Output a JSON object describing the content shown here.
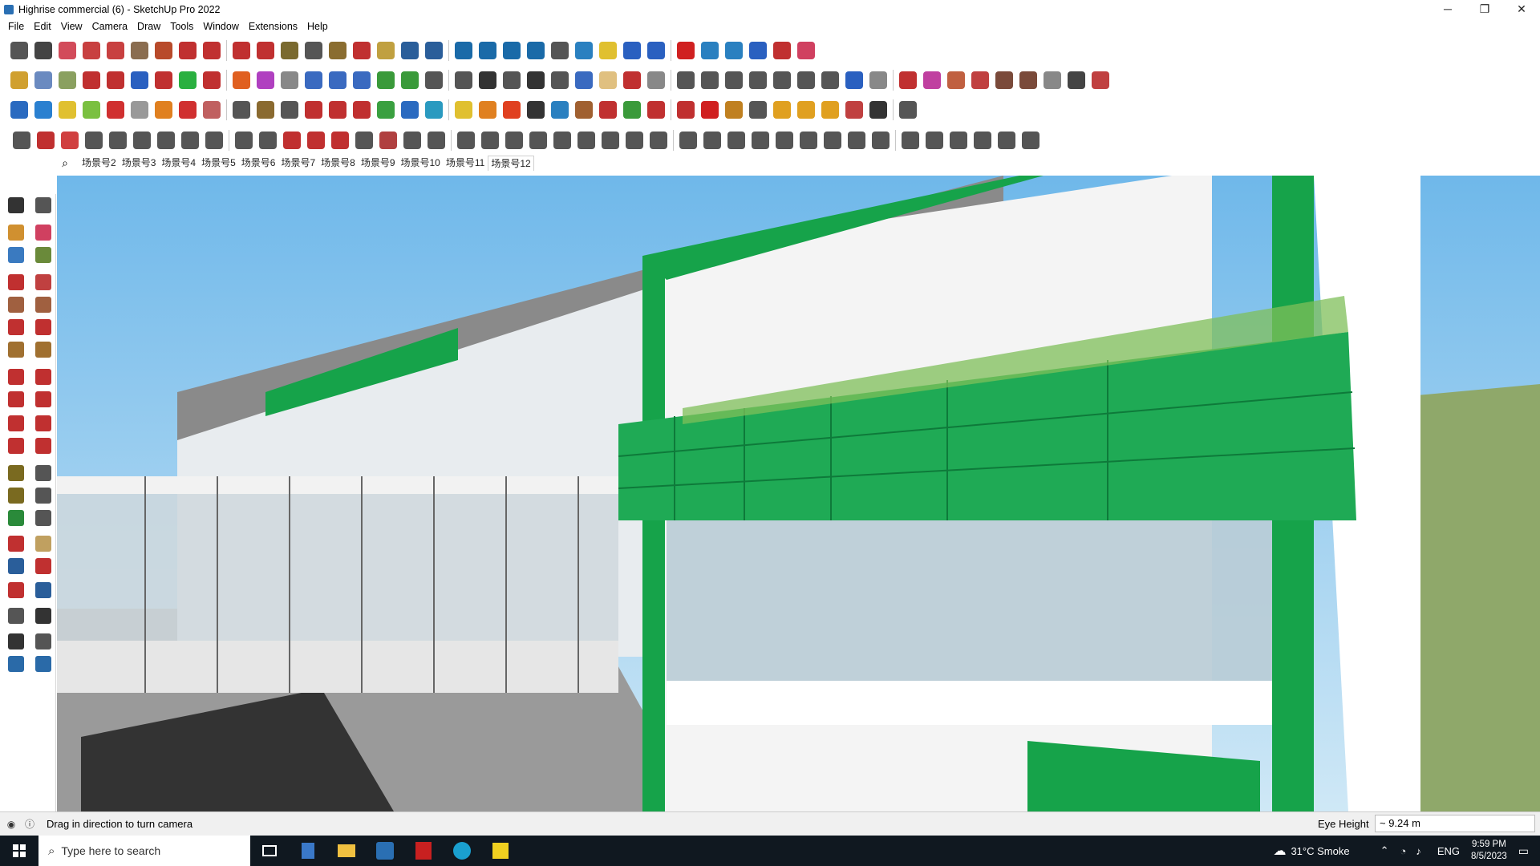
{
  "window": {
    "title": "Highrise commercial (6) - SketchUp Pro 2022",
    "minimize": "─",
    "maximize": "❐",
    "close": "✕"
  },
  "menu": [
    "File",
    "Edit",
    "View",
    "Camera",
    "Draw",
    "Tools",
    "Window",
    "Extensions",
    "Help"
  ],
  "toolbars": {
    "row1": [
      "#555",
      "#444",
      "#d24b5a",
      "#c84040",
      "#c84040",
      "#8a6d50",
      "#b84a2a",
      "#c03030",
      "#c03030",
      "#c03030",
      "#c03030",
      "#7a6a30",
      "#555",
      "#8a6d30",
      "#c03030",
      "#c0a040",
      "#2a5e9a",
      "#2a5e9a",
      "#1a6aa8",
      "#1a6aa8",
      "#1a6aa8",
      "#1a6aa8",
      "#555",
      "#2a80c0",
      "#e0c030",
      "#2a60c0",
      "#2a60c0",
      "#d02020",
      "#2a80c0",
      "#2a80c0",
      "#2a60c0",
      "#c03030",
      "#d04060"
    ],
    "row2": [
      "#d0a030",
      "#6a8ac0",
      "#8aa060",
      "#c03030",
      "#c03030",
      "#2a60c0",
      "#c03030",
      "#2ab040",
      "#c03030",
      "#e06020",
      "#b040c0",
      "#888",
      "#3a6ac0",
      "#3a6ac0",
      "#3a6ac0",
      "#3a9a3a",
      "#3a9a3a",
      "#555",
      "#555",
      "#333",
      "#555",
      "#333",
      "#555",
      "#3a6ac0",
      "#e0c080",
      "#c03030",
      "#888",
      "#555",
      "#555",
      "#555",
      "#555",
      "#555",
      "#555",
      "#555",
      "#2a60c0",
      "#888",
      "#c03030",
      "#c040a0",
      "#c06040",
      "#c04040",
      "#7a4a3a",
      "#7a4a3a",
      "#888",
      "#444",
      "#c04040"
    ],
    "row3": [
      "#2a6ac0",
      "#2a80d0",
      "#e0c030",
      "#7ac040",
      "#d03030",
      "#999",
      "#e08020",
      "#d03030",
      "#c06060",
      "#555",
      "#8a6a30",
      "#555",
      "#c03030",
      "#c03030",
      "#c03030",
      "#3aa040",
      "#2a6ac0",
      "#2a9ac0",
      "#e0c030",
      "#e08020",
      "#e04020",
      "#333",
      "#2a80c0",
      "#a06030",
      "#c03030",
      "#3a9a3a",
      "#c03030",
      "#c03030",
      "#d02020",
      "#c08020",
      "#555",
      "#e0a020",
      "#e0a020",
      "#e0a020",
      "#c04040",
      "#333",
      "#555"
    ],
    "row4": [
      "#555",
      "#c03030",
      "#d04040",
      "#555",
      "#555",
      "#555",
      "#555",
      "#555",
      "#555",
      "#555",
      "#555",
      "#c03030",
      "#c03030",
      "#c03030",
      "#555",
      "#b04040",
      "#555",
      "#555",
      "#555",
      "#555",
      "#555",
      "#555",
      "#555",
      "#555",
      "#555",
      "#555",
      "#555",
      "#555",
      "#555",
      "#555",
      "#555",
      "#555",
      "#555",
      "#555",
      "#555",
      "#555",
      "#555",
      "#555",
      "#555",
      "#555",
      "#555",
      "#555"
    ]
  },
  "scenes": [
    "场景号2",
    "场景号3",
    "场景号4",
    "场景号5",
    "场景号6",
    "场景号7",
    "场景号8",
    "场景号9",
    "场景号10",
    "场景号11",
    "场景号12"
  ],
  "status": {
    "message": "Drag in direction to turn camera",
    "vcb_label": "Eye Height",
    "vcb_value": "~ 9.24 m"
  },
  "taskbar": {
    "search_placeholder": "Type here to search",
    "weather": "31°C  Smoke",
    "lang": "ENG",
    "time": "9:59 PM",
    "date": "8/5/2023"
  }
}
